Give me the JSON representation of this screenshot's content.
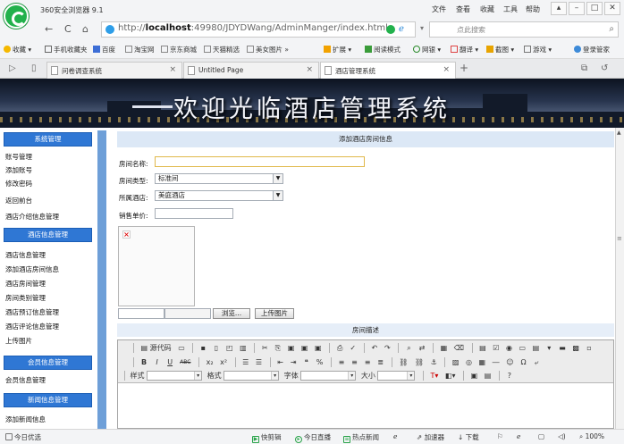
{
  "browser": {
    "title": "360安全浏览器 9.1",
    "menus": [
      "文件",
      "查看",
      "收藏",
      "工具",
      "帮助"
    ],
    "url_prefix": "http://",
    "url_host": "localhost",
    "url_rest": ":49980/JDYDWang/AdminManger/index.html",
    "search_placeholder": "点此搜索",
    "bookmarks": [
      "收藏",
      "手机收藏夹",
      "百度",
      "淘宝网",
      "京东商城",
      "天猫精选",
      "美女图片 »"
    ],
    "extensions": [
      "扩展",
      "阅读模式",
      "网银",
      "翻译",
      "截图",
      "游戏",
      "登录管家"
    ],
    "tabs": [
      "问卷调查系统",
      "Untitled Page",
      "酒店管理系统"
    ],
    "new_tab": "+",
    "status_left": "今日优选",
    "status_items": [
      "快剪辑",
      "今日直播",
      "热点新闻",
      "加速器",
      "下载"
    ],
    "zoom": "100%"
  },
  "colors": {
    "section_blue": "#2f77d4",
    "form_title_bg": "#dce8f6",
    "logo_green": "#22b14c"
  },
  "banner": {
    "title": "欢迎光临酒店管理系统"
  },
  "sidebar": {
    "sections": [
      {
        "title": "系统管理",
        "items": [
          "账号管理",
          "添加账号",
          "修改密码",
          "返回前台",
          "酒店介绍信息管理"
        ]
      },
      {
        "title": "酒店信息管理",
        "items": [
          "酒店信息管理",
          "添加酒店房间信息",
          "酒店房间管理",
          "房间类别管理",
          "酒店预订信息管理",
          "酒店评论信息管理",
          "上传图片"
        ]
      },
      {
        "title": "会员信息管理",
        "items": [
          "会员信息管理"
        ]
      },
      {
        "title": "新闻信息管理",
        "items": [
          "添加新闻信息"
        ]
      }
    ]
  },
  "form": {
    "title": "添加酒店房间信息",
    "room_name_label": "房间名称:",
    "room_name_value": "",
    "room_type_label": "房间类型:",
    "room_type_value": "标准间",
    "hotel_label": "所属酒店:",
    "hotel_value": "美庭酒店",
    "price_label": "销售单价:",
    "price_value": "",
    "browse_button": "浏览...",
    "upload_button": "上传图片",
    "description_title": "房间描述"
  },
  "editor": {
    "source_button": "源代码",
    "style_label": "样式",
    "format_label": "格式",
    "font_label": "字体",
    "size_label": "大小"
  }
}
